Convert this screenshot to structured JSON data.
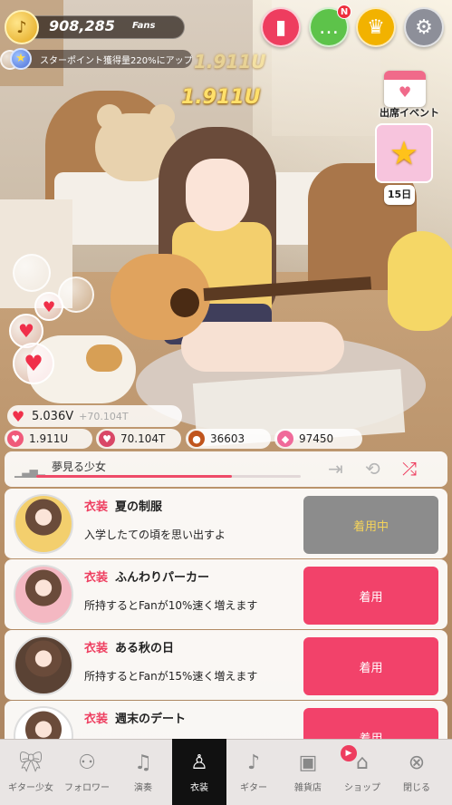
{
  "hud": {
    "fans_value": "908,285",
    "fans_unit": "Fans",
    "boost_text": "スターポイント獲得量220%にアップ",
    "float_value_faded": "1.911U",
    "float_value": "1.911U",
    "chat_badge": "N"
  },
  "event": {
    "attend_label": "出席イベント",
    "day_count": "15日"
  },
  "stats": {
    "v_value": "5.036V",
    "v_rate": "+70.104T",
    "u_value": "1.911U",
    "t_value": "70.104T",
    "ball_value": "36603",
    "gem_value": "97450"
  },
  "music": {
    "song_title": "夢見る少女",
    "progress_fraction": 0.74
  },
  "outfits": [
    {
      "category": "衣装",
      "name": "夏の制服",
      "desc": "入学したての頃を思い出すよ",
      "button": "着用中",
      "state": "equipped"
    },
    {
      "category": "衣装",
      "name": "ふんわりパーカー",
      "desc": "所持するとFanが10%速く増えます",
      "button": "着用",
      "state": "available"
    },
    {
      "category": "衣装",
      "name": "ある秋の日",
      "desc": "所持するとFanが15%速く増えます",
      "button": "着用",
      "state": "available"
    },
    {
      "category": "衣装",
      "name": "週末のデート",
      "desc": "",
      "button": "着用",
      "state": "available"
    }
  ],
  "nav": [
    {
      "label": "ギター少女",
      "icon": "ribbon-icon"
    },
    {
      "label": "フォロワー",
      "icon": "followers-icon"
    },
    {
      "label": "演奏",
      "icon": "music-note-icon"
    },
    {
      "label": "衣装",
      "icon": "dress-icon",
      "active": true
    },
    {
      "label": "ギター",
      "icon": "guitar-icon"
    },
    {
      "label": "雑貨店",
      "icon": "gift-icon"
    },
    {
      "label": "ショップ",
      "icon": "shop-icon"
    },
    {
      "label": "閉じる",
      "icon": "close-icon"
    }
  ],
  "colors": {
    "accent_pink": "#ee3d5f",
    "equip_pink": "#f2426a",
    "equipped_gray": "#8c8c8c",
    "gold": "#f2b200"
  }
}
